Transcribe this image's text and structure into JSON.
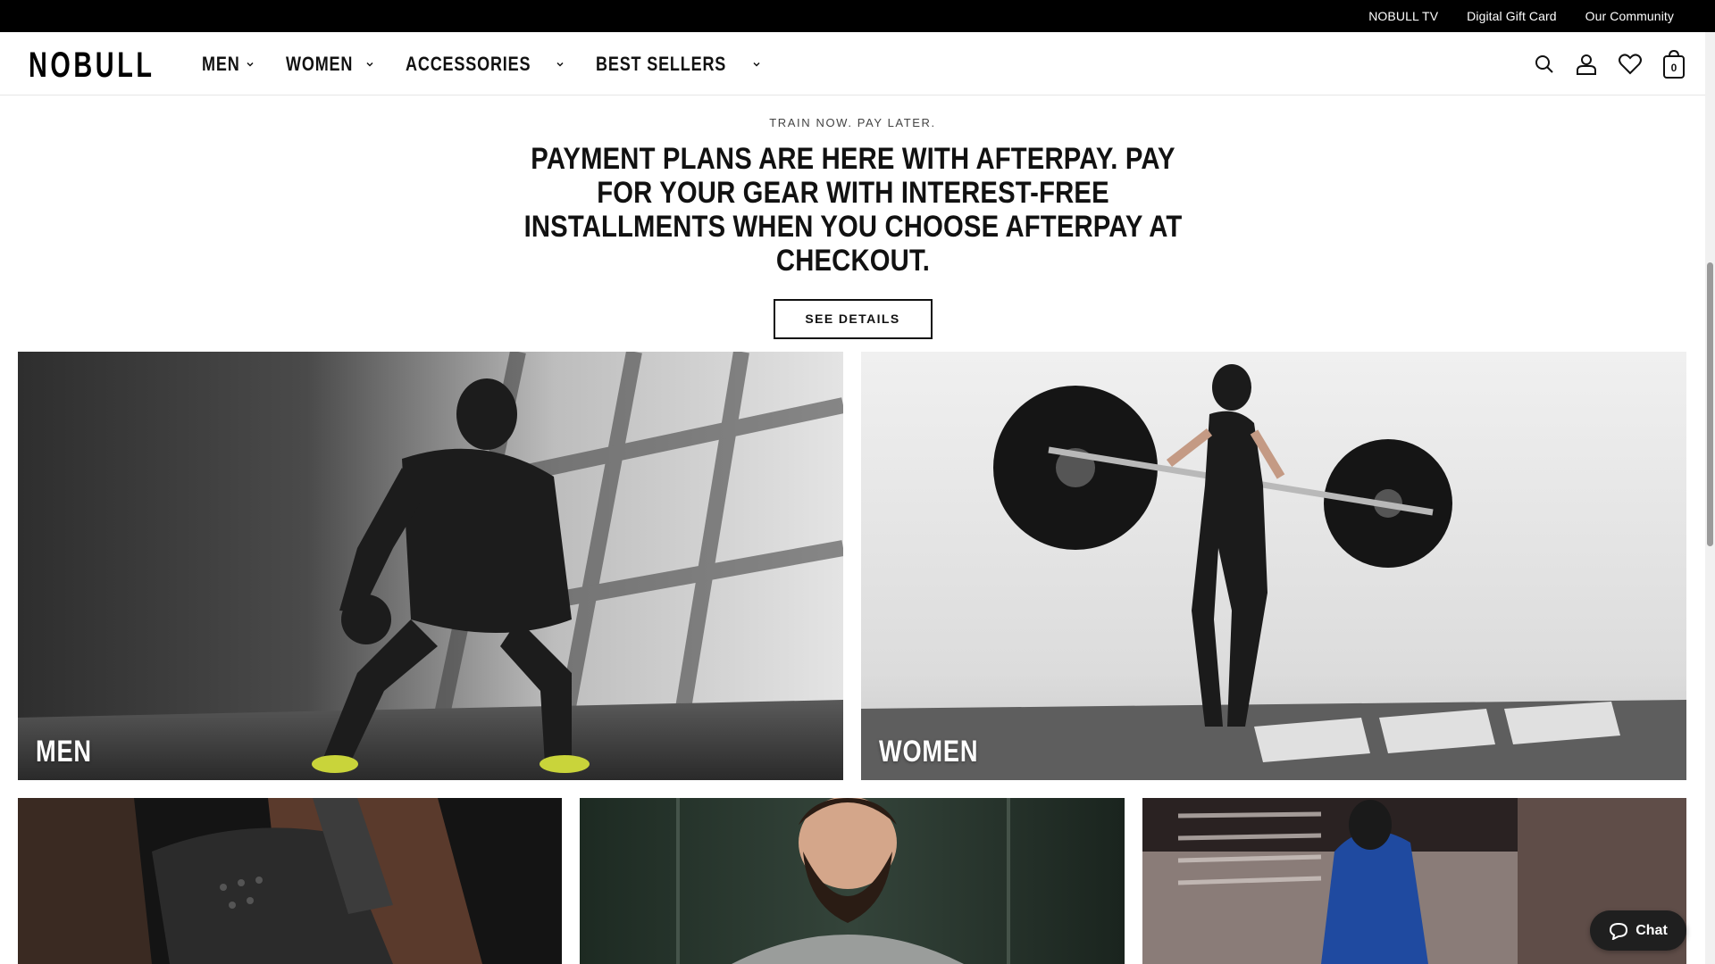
{
  "utility_bar": {
    "links": [
      "NOBULL TV",
      "Digital Gift Card",
      "Our Community"
    ]
  },
  "header": {
    "logo": "NOBULL",
    "nav": [
      "MEN",
      "WOMEN",
      "ACCESSORIES",
      "BEST SELLERS"
    ],
    "icons": [
      "search-icon",
      "account-icon",
      "wishlist-heart-icon",
      "cart-bag-icon"
    ],
    "cart_count": "0"
  },
  "promo": {
    "eyebrow": "TRAIN NOW. PAY LATER.",
    "headline": "PAYMENT PLANS ARE HERE WITH AFTERPAY. PAY FOR YOUR GEAR WITH INTEREST-FREE INSTALLMENTS WHEN YOU CHOOSE AFTERPAY AT CHECKOUT.",
    "button": "SEE DETAILS"
  },
  "tiles": {
    "men": "MEN",
    "women": "WOMEN"
  },
  "chat": {
    "label": "Chat"
  },
  "colors": {
    "utility_bar_bg": "#000000",
    "text": "#111111",
    "chat_bg": "#1f1f1f"
  }
}
